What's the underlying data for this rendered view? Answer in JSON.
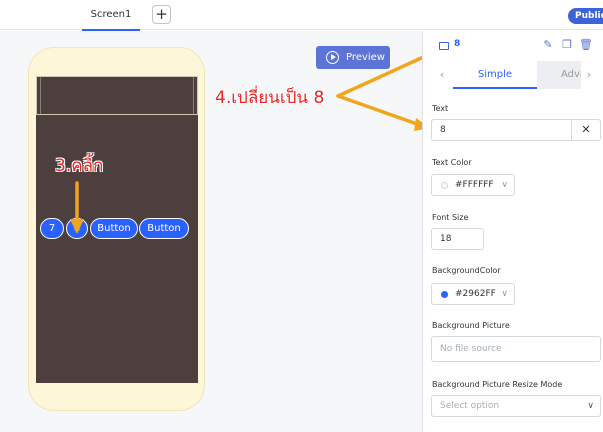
{
  "tabs": {
    "screen": "Screen1",
    "add": "+"
  },
  "header": {
    "public_label": "Public"
  },
  "canvas": {
    "preview_label": "Preview",
    "buttons": [
      "7",
      "8",
      "Button",
      "Button"
    ]
  },
  "annotations": {
    "click_note": "3.คลิ้ก",
    "change_note": "4.เปลี่ยนเป็น 8"
  },
  "panel": {
    "component_name": "8",
    "tab_simple": "Simple",
    "tab_advanced": "Advanced",
    "text_label": "Text",
    "text_value": "8",
    "clear_glyph": "✕",
    "text_color_label": "Text Color",
    "text_color_value": "#FFFFFF",
    "font_size_label": "Font Size",
    "font_size_value": "18",
    "bg_color_label": "BackgroundColor",
    "bg_color_value": "#2962FF",
    "bg_picture_label": "Background Picture",
    "bg_picture_placeholder": "No file source",
    "resize_mode_label": "Background Picture Resize Mode",
    "resize_mode_placeholder": "Select option"
  },
  "colors": {
    "accent": "#2962ff",
    "annotation": "#ef2323",
    "arrow": "#f2a51c",
    "app_bg": "#4e3f3f",
    "phone_frame": "#fdf6d8"
  }
}
